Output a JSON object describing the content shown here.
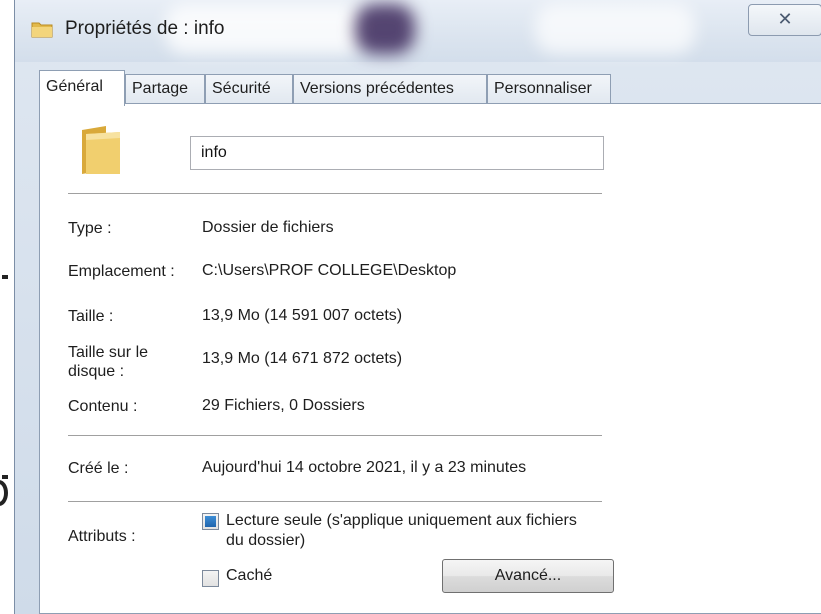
{
  "window": {
    "title": "Propriétés de : info",
    "close_glyph": "✕"
  },
  "tabs": [
    {
      "label": "Général",
      "active": true
    },
    {
      "label": "Partage",
      "active": false
    },
    {
      "label": "Sécurité",
      "active": false
    },
    {
      "label": "Versions précédentes",
      "active": false
    },
    {
      "label": "Personnaliser",
      "active": false
    }
  ],
  "general": {
    "icon": "folder-icon",
    "name_value": "info",
    "fields": {
      "type_label": "Type :",
      "type_value": "Dossier de fichiers",
      "location_label": "Emplacement :",
      "location_value": "C:\\Users\\PROF COLLEGE\\Desktop",
      "size_label": "Taille :",
      "size_value": "13,9 Mo (14 591 007 octets)",
      "disk_size_label": "Taille sur le disque :",
      "disk_size_value": "13,9 Mo (14 671 872 octets)",
      "contents_label": "Contenu :",
      "contents_value": "29 Fichiers, 0 Dossiers",
      "created_label": "Créé le :",
      "created_value": "Aujourd'hui 14 octobre 2021, il y a 23 minutes",
      "attributes_label": "Attributs :"
    },
    "attributes": {
      "readonly_label": "Lecture seule (s'applique uniquement aux fichiers du dossier)",
      "readonly_state": "indeterminate",
      "hidden_label": "Caché",
      "hidden_checked": false,
      "advanced_button": "Avancé..."
    }
  },
  "colors": {
    "accent": "#2f7fcf",
    "window_frame": "#d3deeb",
    "panel": "#ffffff"
  }
}
